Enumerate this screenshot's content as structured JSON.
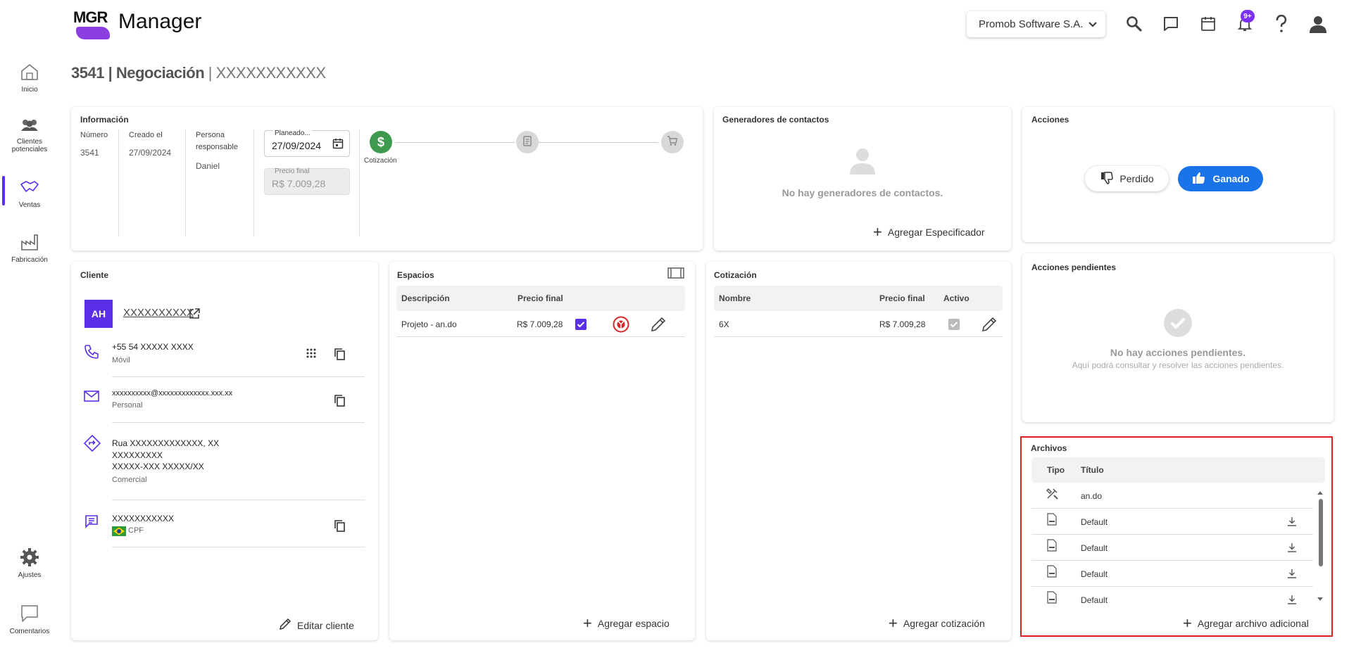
{
  "app": {
    "logo_text": "MGR",
    "name": "Manager"
  },
  "header": {
    "company": "Promob Software S.A.",
    "notifications_badge": "9+"
  },
  "sidebar": {
    "items": [
      {
        "label": "Inicio",
        "icon": "home-icon"
      },
      {
        "label": "Clientes potenciales",
        "icon": "people-icon"
      },
      {
        "label": "Ventas",
        "icon": "handshake-icon",
        "active": true
      },
      {
        "label": "Fabricación",
        "icon": "factory-icon"
      },
      {
        "label": "Ajustes",
        "icon": "gear-icon"
      },
      {
        "label": "Comentarios",
        "icon": "comment-icon"
      }
    ]
  },
  "page": {
    "title_number": "3541",
    "title_section": "Negociación",
    "title_client": "XXXXXXXXXXX"
  },
  "informacion": {
    "title": "Información",
    "numero_label": "Número",
    "numero": "3541",
    "creado_label": "Creado el",
    "creado": "27/09/2024",
    "persona_label": "Persona responsable",
    "persona": "Daniel",
    "planeado_label": "Planeado...",
    "planeado": "27/09/2024",
    "precio_label": "Precio final",
    "precio": "R$ 7.009,28",
    "step_label": "Cotización"
  },
  "generadores": {
    "title": "Generadores de contactos",
    "empty": "No hay generadores de contactos.",
    "add": "Agregar Especificador"
  },
  "acciones": {
    "title": "Acciones",
    "perdido": "Perdido",
    "ganado": "Ganado"
  },
  "pendientes": {
    "title": "Acciones pendientes",
    "empty_title": "No hay acciones pendientes.",
    "empty_sub": "Aquí podrá consultar y resolver las acciones pendientes."
  },
  "cliente": {
    "title": "Cliente",
    "initials": "AH",
    "name": "XXXXXXXXXX",
    "phone": "+55 54 XXXXX XXXX",
    "phone_type": "Móvil",
    "email": "xxxxxxxxxx@xxxxxxxxxxxxx.xxx.xx",
    "email_type": "Personal",
    "address1": "Rua XXXXXXXXXXXXX, XX",
    "address2": "XXXXXXXXX",
    "address3": "XXXXX-XXX XXXXX/XX",
    "address_type": "Comercial",
    "doc": "XXXXXXXXXXX",
    "doc_type": "CPF",
    "edit": "Editar cliente"
  },
  "espacios": {
    "title": "Espacios",
    "col_desc": "Descripción",
    "col_price": "Precio final",
    "row_desc": "Projeto - an.do",
    "row_price": "R$ 7.009,28",
    "add": "Agregar espacio"
  },
  "cotizacion": {
    "title": "Cotización",
    "col_name": "Nombre",
    "col_price": "Precio final",
    "col_active": "Activo",
    "row_name": "6X",
    "row_price": "R$ 7.009,28",
    "add": "Agregar cotización"
  },
  "archivos": {
    "title": "Archivos",
    "col_type": "Tipo",
    "col_title": "Título",
    "rows": [
      {
        "title": "an.do",
        "icon": "tools-icon"
      },
      {
        "title": "Default",
        "icon": "pdf-file-icon"
      },
      {
        "title": "Default",
        "icon": "pdf-file-icon"
      },
      {
        "title": "Default",
        "icon": "pdf-file-icon"
      },
      {
        "title": "Default",
        "icon": "pdf-file-icon"
      }
    ],
    "add": "Agregar archivo adicional"
  },
  "colors": {
    "accent": "#5b2ee8",
    "ganado": "#1a73e8",
    "step_active": "#3d9a4f",
    "highlight": "#e02020"
  }
}
